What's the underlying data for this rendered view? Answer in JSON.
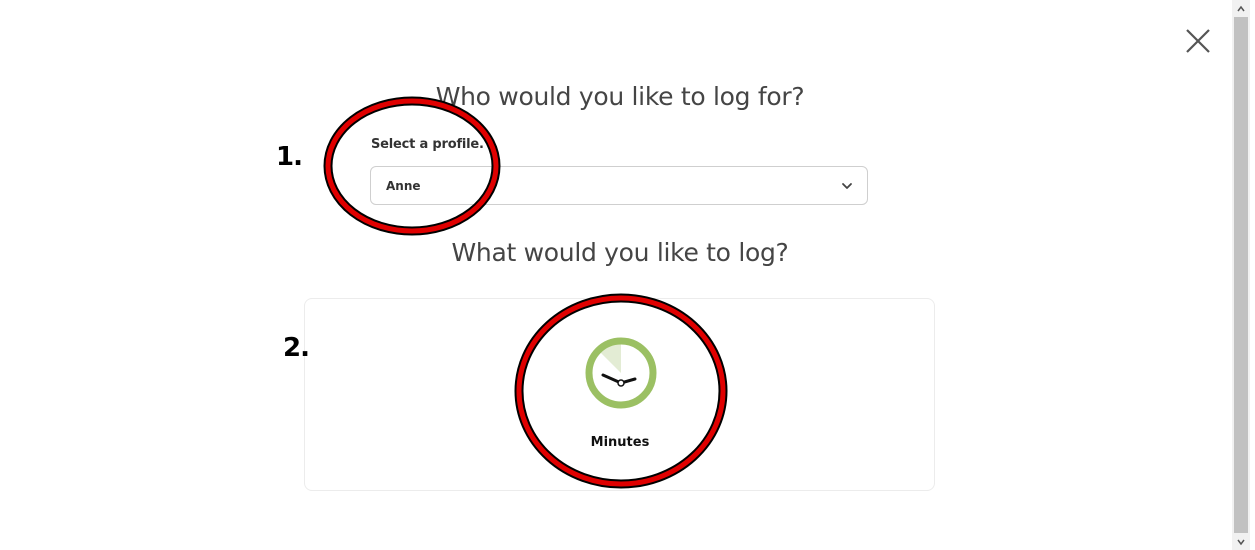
{
  "dialog": {
    "close_icon": "close-icon",
    "profile_heading": "Who would you like to log for?",
    "profile_label": "Select a profile.",
    "profile_selected": "Anne",
    "log_heading": "What would you like to log?",
    "log_options": [
      {
        "label": "Minutes",
        "icon": "clock-icon"
      }
    ]
  },
  "annotations": {
    "step1": "1.",
    "step2": "2.",
    "ring_color": "#e00000"
  },
  "colors": {
    "accent_green": "#9bc063",
    "light_green": "#e3ecd4"
  }
}
